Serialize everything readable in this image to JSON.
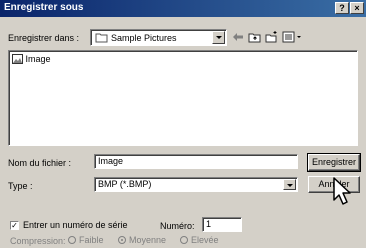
{
  "window": {
    "title": "Enregistrer sous",
    "help_label": "?",
    "close_label": "×"
  },
  "location": {
    "label": "Enregistrer dans :",
    "value": "Sample Pictures"
  },
  "toolbar": {
    "icons": [
      "back-icon",
      "up-folder-icon",
      "new-folder-icon",
      "view-menu-icon"
    ]
  },
  "files": [
    {
      "name": "Image",
      "icon": "image-file-icon"
    }
  ],
  "filename": {
    "label": "Nom du fichier :",
    "value": "Image"
  },
  "filetype": {
    "label": "Type :",
    "value": "BMP (*.BMP)"
  },
  "buttons": {
    "save": "Enregistrer",
    "cancel": "Annuler"
  },
  "serial": {
    "checkbox_label": "Entrer un numéro de série",
    "checked": true,
    "number_label": "Numéro:",
    "number_value": "1"
  },
  "compression": {
    "label": "Compression:",
    "options": [
      {
        "label": "Faible",
        "checked": false
      },
      {
        "label": "Moyenne",
        "checked": true
      },
      {
        "label": "Elevée",
        "checked": false
      }
    ]
  }
}
